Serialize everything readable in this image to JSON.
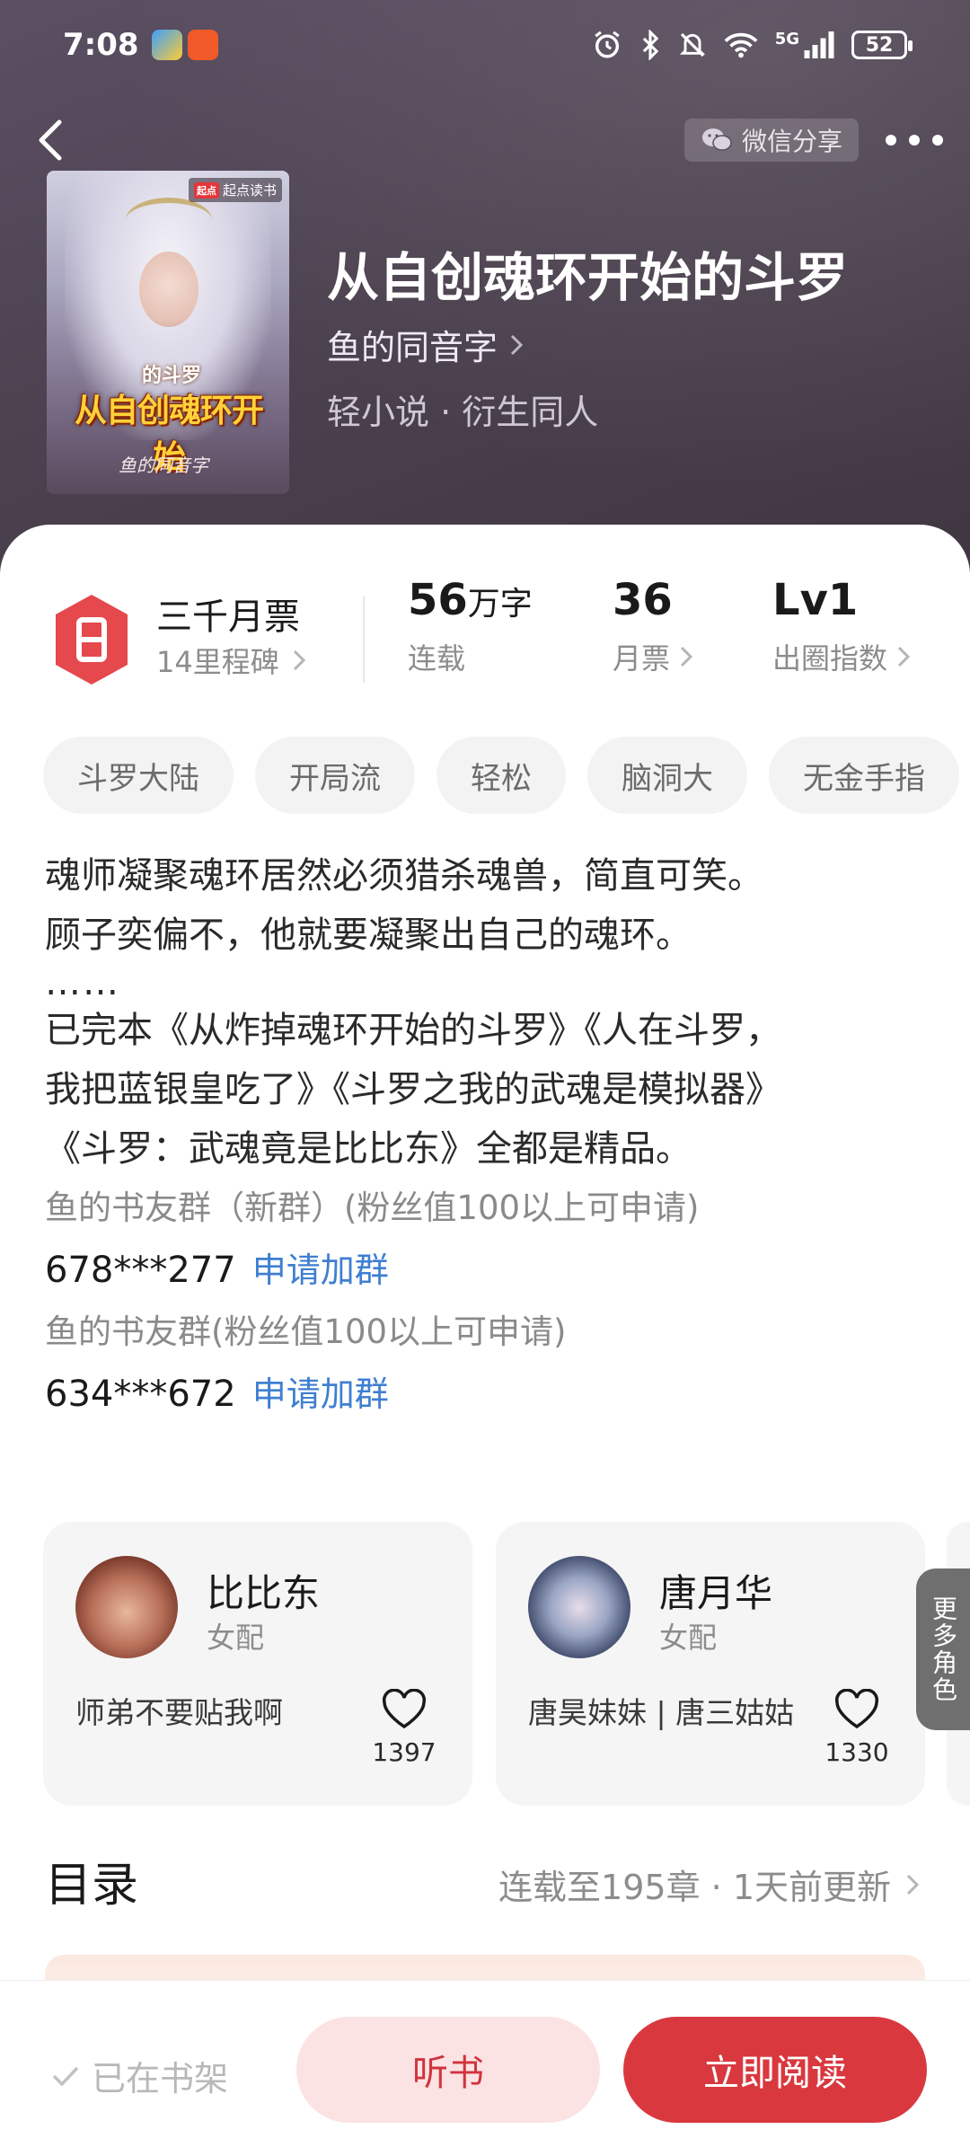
{
  "status_bar": {
    "time": "7:08",
    "network": "5G",
    "battery": "52"
  },
  "header": {
    "share_label": "微信分享",
    "cover": {
      "badge": "起点读书",
      "subtitle": "的斗罗",
      "title": "从自创魂环开始",
      "author": "鱼的同音字"
    },
    "book_title": "从自创魂环开始的斗罗",
    "author": "鱼的同音字",
    "meta": "轻小说 · 衍生同人"
  },
  "stats": {
    "ticket_title": "三千月票",
    "ticket_sub": "14里程碑",
    "word_count": "56",
    "word_unit": "万字",
    "word_label": "连载",
    "monthly_tickets": "36",
    "monthly_label": "月票",
    "level": "Lv1",
    "level_label": "出圈指数"
  },
  "tags": [
    "斗罗大陆",
    "开局流",
    "轻松",
    "脑洞大",
    "无金手指"
  ],
  "intro": {
    "lines": [
      "魂师凝聚魂环居然必须猎杀魂兽，简直可笑。",
      "顾子奕偏不，他就要凝聚出自己的魂环。",
      "……",
      "已完本《从炸掉魂环开始的斗罗》《人在斗罗，",
      "我把蓝银皇吃了》《斗罗之我的武魂是模拟器》",
      "《斗罗：武魂竟是比比东》全都是精品。"
    ],
    "groups": [
      {
        "label": "鱼的书友群（新群）(粉丝值100以上可申请)",
        "number": "678***277",
        "action": "申请加群"
      },
      {
        "label": "鱼的书友群(粉丝值100以上可申请)",
        "number": "634***672",
        "action": "申请加群"
      }
    ]
  },
  "characters": [
    {
      "name": "比比东",
      "role": "女配",
      "desc": "师弟不要贴我啊",
      "likes": "1397"
    },
    {
      "name": "唐月华",
      "role": "女配",
      "desc": "唐昊妹妹 | 唐三姑姑",
      "likes": "1330"
    }
  ],
  "more_roles": "更多角色",
  "toc": {
    "title": "目录",
    "status": "连载至195章 · 1天前更新"
  },
  "bottom": {
    "shelf_state": "已在书架",
    "listen": "听书",
    "read": "立即阅读"
  },
  "colors": {
    "accent_red": "#d9383f",
    "link_blue": "#3f7fd1",
    "header_bg": "#4d4250"
  }
}
